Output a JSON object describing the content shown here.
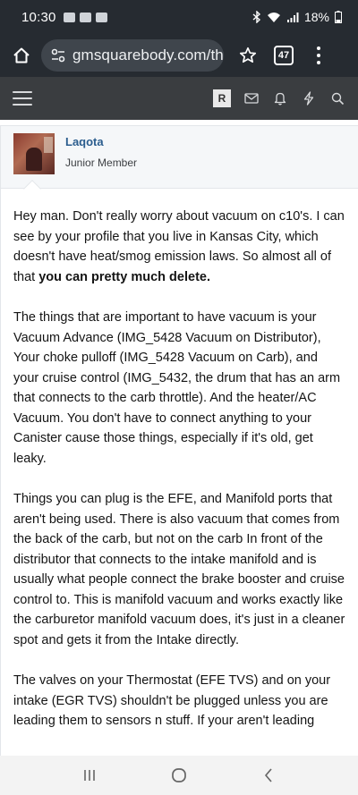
{
  "status_bar": {
    "time": "10:30",
    "battery": "18%"
  },
  "browser": {
    "url": "gmsquarebody.com/th",
    "tab_count": "47"
  },
  "site_header": {
    "avatar_letter": "R"
  },
  "post": {
    "username": "Laqota",
    "user_title": "Junior Member",
    "paragraphs": [
      {
        "text": "Hey man. Don't really worry about vacuum on c10's. I can see by your profile that you live in Kansas City, which doesn't have heat/smog emission laws. So almost all of that ",
        "bold": "you can pretty much delete."
      },
      {
        "text": "The things that are important to have vacuum is your Vacuum Advance (IMG_5428 Vacuum on Distributor), Your choke pulloff (IMG_5428 Vacuum on Carb), and your cruise control (IMG_5432, the drum that has an arm that connects to the carb throttle). And the heater/AC Vacuum. You don't have to connect anything to your Canister cause those things, especially if it's old, get leaky."
      },
      {
        "text": "Things you can plug is the EFE, and Manifold ports that aren't being used. There is also vacuum that comes from the back of the carb, but not on the carb In front of the distributor that connects to the intake manifold and is usually what people connect the brake booster and cruise control to. This is manifold vacuum and works exactly like the carburetor manifold vacuum does, it's just in a cleaner spot and gets it from the Intake directly."
      },
      {
        "text": "The valves on your Thermostat (EFE TVS) and on your intake (EGR TVS) shouldn't be plugged unless you are leading them to sensors n stuff. If your aren't leading"
      }
    ]
  },
  "colors": {
    "status_bg": "#262b31",
    "site_header_bg": "#3a3d40",
    "username": "#2b5d8e",
    "user_row_bg": "#f5f7f9"
  }
}
